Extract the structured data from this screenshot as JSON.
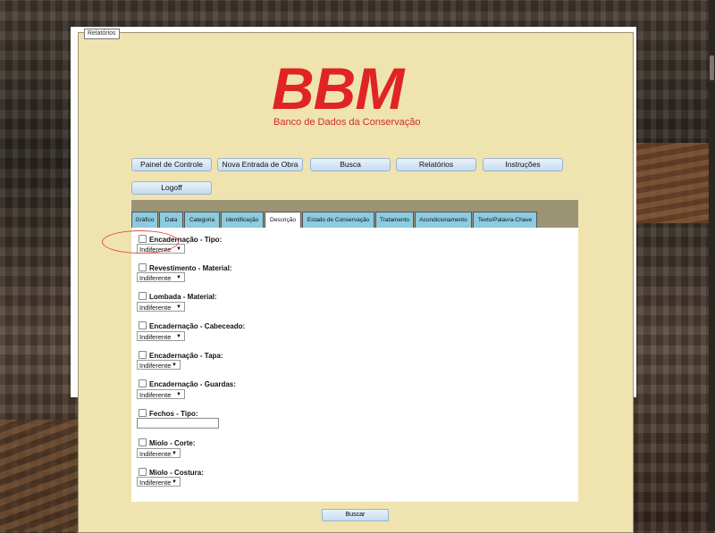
{
  "frame": {
    "legend": "Relatórios"
  },
  "logo": {
    "title": "BBM",
    "subtitle": "Banco de Dados da Conservação"
  },
  "nav": [
    {
      "label": "Painel de Controle"
    },
    {
      "label": "Nova Entrada de Obra"
    },
    {
      "label": "Busca"
    },
    {
      "label": "Relatórios"
    },
    {
      "label": "Instruções"
    },
    {
      "label": "Logoff"
    }
  ],
  "tabs": [
    {
      "label": "Gráfico"
    },
    {
      "label": "Data"
    },
    {
      "label": "Categoria"
    },
    {
      "label": "Identificação"
    },
    {
      "label": "Descrição",
      "active": true
    },
    {
      "label": "Estado de Conservação"
    },
    {
      "label": "Tratamento"
    },
    {
      "label": "Acondicionamento"
    },
    {
      "label": "Texto/Palavra-Chave"
    }
  ],
  "fields": [
    {
      "label": "Encadernação - Tipo:",
      "control": "select",
      "value": "Indiferente"
    },
    {
      "label": "Revestimento - Material:",
      "control": "select",
      "value": "Indiferente"
    },
    {
      "label": "Lombada - Material:",
      "control": "select",
      "value": "Indiferente"
    },
    {
      "label": "Encadernação - Cabeceado:",
      "control": "select",
      "value": "Indiferente"
    },
    {
      "label": "Encadernação - Tapa:",
      "control": "select",
      "value": "Indiferente"
    },
    {
      "label": "Encadernação - Guardas:",
      "control": "select",
      "value": "Indiferente"
    },
    {
      "label": "Fechos - Tipo:",
      "control": "text",
      "value": ""
    },
    {
      "label": "Miolo - Corte:",
      "control": "select",
      "value": "Indiferente"
    },
    {
      "label": "Miolo - Costura:",
      "control": "select",
      "value": "Indiferente"
    }
  ],
  "submit": {
    "label": "Buscar"
  },
  "colors": {
    "brand_red": "#e02424",
    "frame_bg": "#efe4b0",
    "tab_bg": "#8ccbe0",
    "tabbar_bg": "#9b9474"
  }
}
